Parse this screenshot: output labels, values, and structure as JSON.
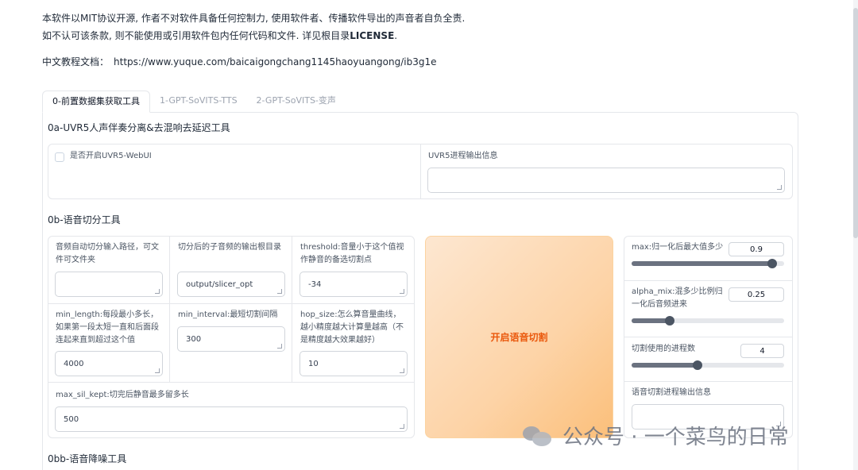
{
  "notice": {
    "line1": "本软件以MIT协议开源, 作者不对软件具备任何控制力, 使用软件者、传播软件导出的声音者自负全责.",
    "line2a": "如不认可该条款, 则不能使用或引用软件包内任何代码和文件. 详见根目录",
    "line2b": "LICENSE",
    "line2c": ".",
    "tutorial_label": "中文教程文档：",
    "tutorial_url": "https://www.yuque.com/baicaigongchang1145haoyuangong/ib3g1e"
  },
  "tabs": [
    "0-前置数据集获取工具",
    "1-GPT-SoVITS-TTS",
    "2-GPT-SoVITS-变声"
  ],
  "uvr5": {
    "title": "0a-UVR5人声伴奏分离&去混响去延迟工具",
    "checkbox_label": "是否开启UVR5-WebUI",
    "output_label": "UVR5进程输出信息",
    "output_value": ""
  },
  "slicer": {
    "title": "0b-语音切分工具",
    "input_path_label": "音频自动切分输入路径，可文件可文件夹",
    "input_path_value": "",
    "output_dir_label": "切分后的子音频的输出根目录",
    "output_dir_value": "output/slicer_opt",
    "threshold_label": "threshold:音量小于这个值视作静音的备选切割点",
    "threshold_value": "-34",
    "min_length_label": "min_length:每段最小多长，如果第一段太短一直和后面段连起来直到超过这个值",
    "min_length_value": "4000",
    "min_interval_label": "min_interval:最短切割间隔",
    "min_interval_value": "300",
    "hop_size_label": "hop_size:怎么算音量曲线，越小精度越大计算量越高（不是精度越大效果越好）",
    "hop_size_value": "10",
    "max_sil_label": "max_sil_kept:切完后静音最多留多长",
    "max_sil_value": "500",
    "start_button": "开启语音切割",
    "max_label": "max:归一化后最大值多少",
    "max_value": "0.9",
    "max_fraction": 0.92,
    "alpha_label": "alpha_mix:混多少比例归一化后音频进来",
    "alpha_value": "0.25",
    "alpha_fraction": 0.25,
    "parts_label": "切割使用的进程数",
    "parts_value": "4",
    "parts_fraction": 0.43,
    "output_info_label": "语音切割进程输出信息",
    "output_info_value": ""
  },
  "denoise": {
    "title": "0bb-语音降噪工具"
  },
  "watermark": "公众号 · 一个菜鸟的日常"
}
